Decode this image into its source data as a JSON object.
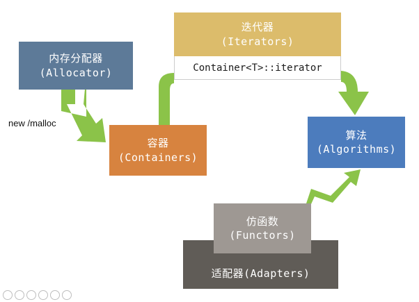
{
  "diagram": {
    "allocator": {
      "zh": "内存分配器",
      "en": "(Allocator)"
    },
    "containers": {
      "zh": "容器",
      "en": "(Containers)"
    },
    "iterators": {
      "zh": "迭代器",
      "en": "(Iterators)",
      "sub": "Container<T>::iterator"
    },
    "algorithms": {
      "zh": "算法",
      "en": "(Algorithms)"
    },
    "functors": {
      "zh": "仿函数",
      "en": "(Functors)"
    },
    "adapters": {
      "label": "适配器(Adapters)"
    },
    "note": "new /malloc"
  },
  "colors": {
    "allocator": "#5d7a98",
    "containers": "#d7833f",
    "iterators": "#dcbc6b",
    "algorithms": "#4c7cbd",
    "functors": "#9e9893",
    "adapters": "#605c57",
    "arrow": "#8bc349"
  },
  "toolbar_icons": [
    "back-icon",
    "forward-icon",
    "edit-icon",
    "print-icon",
    "zoom-icon",
    "more-icon"
  ]
}
